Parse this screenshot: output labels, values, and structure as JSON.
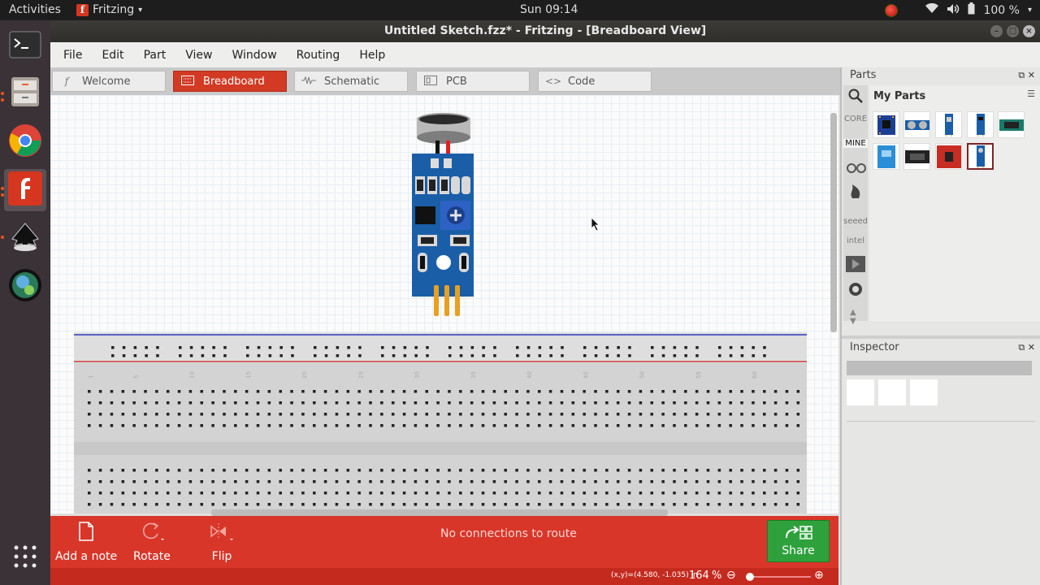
{
  "system": {
    "activities": "Activities",
    "app_menu": "Fritzing",
    "app_menu_icon": "f",
    "clock": "Sun 09:14",
    "battery": "100 %"
  },
  "window": {
    "title": "Untitled Sketch.fzz* - Fritzing - [Breadboard View]"
  },
  "menu": [
    "File",
    "Edit",
    "Part",
    "View",
    "Window",
    "Routing",
    "Help"
  ],
  "tabs": [
    {
      "label": "Welcome",
      "icon": "f"
    },
    {
      "label": "Breadboard",
      "icon": "▭"
    },
    {
      "label": "Schematic",
      "icon": "∿"
    },
    {
      "label": "PCB",
      "icon": "▭"
    },
    {
      "label": "Code",
      "icon": "<>"
    }
  ],
  "breadboard": {
    "column_numbers": [
      "1",
      "5",
      "10",
      "15",
      "20",
      "25",
      "30",
      "35",
      "40",
      "45",
      "50",
      "55",
      "60"
    ]
  },
  "bottombar": {
    "add_note": "Add a note",
    "rotate": "Rotate",
    "flip": "Flip",
    "message": "No connections to route",
    "share": "Share"
  },
  "status": {
    "coords": "(x,y)=(4.580, -1.035) in",
    "zoom": "164",
    "zoom_unit": "%"
  },
  "parts_panel": {
    "title": "Parts",
    "bin_title": "My Parts",
    "bins": [
      "CORE",
      "MINE",
      "seeed",
      "intel"
    ]
  },
  "inspector": {
    "title": "Inspector"
  },
  "colors": {
    "accent_red": "#d9362a",
    "share_green": "#2fa13c",
    "sensor_blue": "#1a5ea8"
  }
}
